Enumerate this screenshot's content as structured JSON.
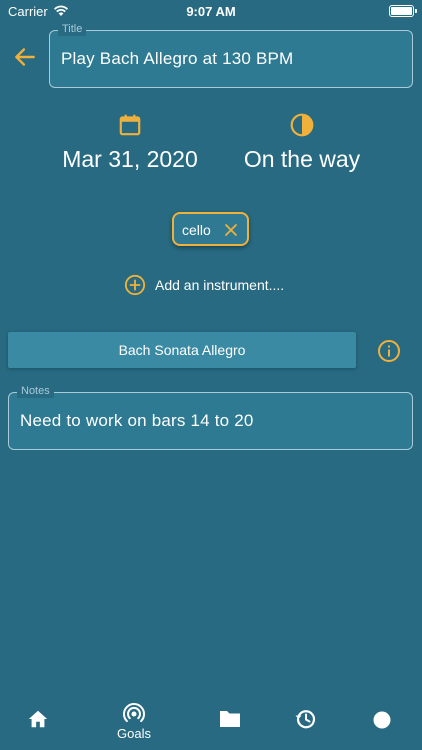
{
  "status_bar": {
    "carrier": "Carrier",
    "time": "9:07 AM"
  },
  "title_field": {
    "label": "Title",
    "value": "Play Bach Allegro at 130 BPM"
  },
  "date": {
    "value": "Mar 31, 2020",
    "icon": "calendar-icon"
  },
  "status": {
    "value": "On the way",
    "icon": "half-circle-icon"
  },
  "instrument_chip": {
    "label": "cello",
    "remove_icon": "close-icon"
  },
  "add_instrument": {
    "label": "Add an instrument....",
    "icon": "add-circle-icon"
  },
  "piece": {
    "label": "Bach Sonata Allegro",
    "info_icon": "info-icon"
  },
  "notes_field": {
    "label": "Notes",
    "value": "Need to work on bars 14 to 20"
  },
  "bottom_nav": {
    "items": [
      {
        "icon": "home-icon",
        "label": ""
      },
      {
        "icon": "goals-icon",
        "label": "Goals"
      },
      {
        "icon": "folder-icon",
        "label": ""
      },
      {
        "icon": "history-icon",
        "label": ""
      },
      {
        "icon": "circle-icon",
        "label": ""
      }
    ]
  },
  "colors": {
    "background": "#276a82",
    "accent": "#f0b13c",
    "field_border": "#a9cad6",
    "button": "#3a8aa3",
    "text": "#ffffff"
  }
}
